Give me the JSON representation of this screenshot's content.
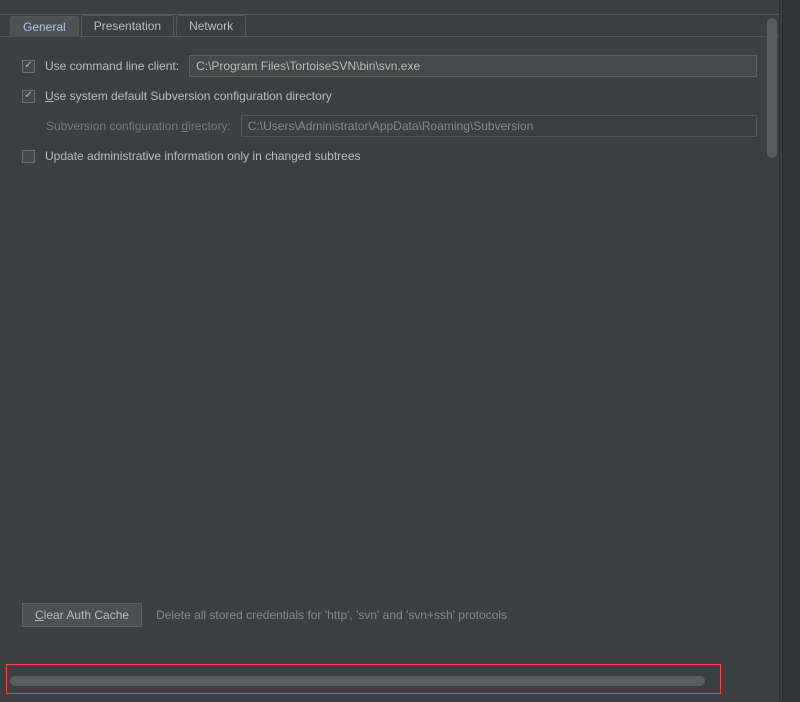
{
  "tabs": {
    "general": "General",
    "presentation": "Presentation",
    "network": "Network"
  },
  "options": {
    "useCli": {
      "label": "Use command line client:",
      "value": "C:\\Program Files\\TortoiseSVN\\bin\\svn.exe",
      "checked": true
    },
    "useSysDefault": {
      "prefix": "U",
      "rest": "se system default Subversion configuration directory",
      "checked": true
    },
    "configDir": {
      "labelPrefix": "Subversion configuration ",
      "labelUnderline": "d",
      "labelRest": "irectory:",
      "value": "C:\\Users\\Administrator\\AppData\\Roaming\\Subversion"
    },
    "updateAdmin": {
      "label": "Update administrative information only in changed subtrees",
      "checked": false
    }
  },
  "bottom": {
    "buttonPrefix": "C",
    "buttonRest": "lear Auth Cache",
    "hint": "Delete all stored credentials for 'http', 'svn' and 'svn+ssh' protocols"
  }
}
